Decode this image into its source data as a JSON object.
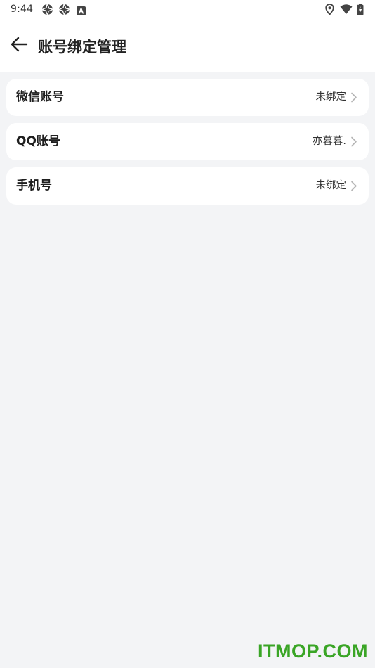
{
  "status_bar": {
    "time": "9:44",
    "left_icons": [
      "aperture-icon",
      "aperture-icon",
      "keyboard-a-icon"
    ],
    "right_icons": [
      "location-icon",
      "wifi-icon",
      "battery-charging-icon"
    ]
  },
  "header": {
    "back_icon": "arrow-left-icon",
    "title": "账号绑定管理"
  },
  "accounts": [
    {
      "label": "微信账号",
      "value": "未绑定"
    },
    {
      "label": "QQ账号",
      "value": "亦暮暮."
    },
    {
      "label": "手机号",
      "value": "未绑定"
    }
  ],
  "watermark": "ITMOP.COM",
  "colors": {
    "page_bg": "#f3f4f6",
    "card_bg": "#ffffff",
    "watermark": "#3aa526"
  }
}
